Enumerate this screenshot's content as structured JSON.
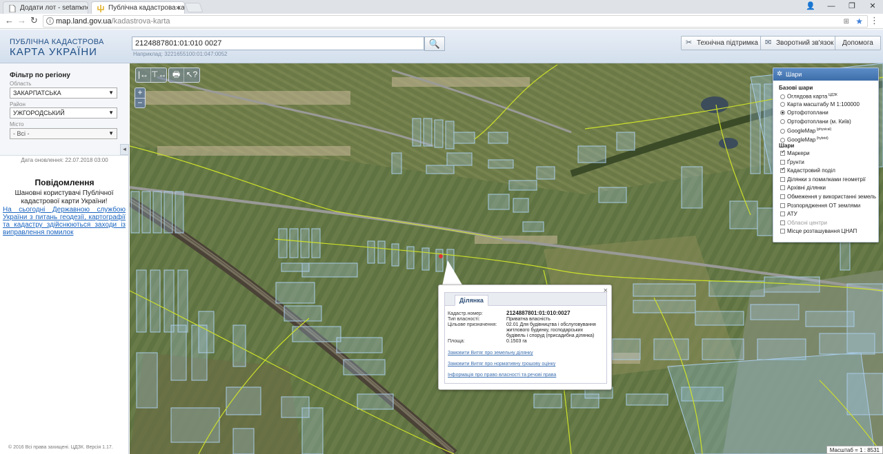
{
  "browser": {
    "tabs": [
      {
        "title": "Додати лот - setam.net.ua",
        "close": "×"
      },
      {
        "title": "Публічна кадастрова ка",
        "close": "×"
      }
    ],
    "window_controls": {
      "user": "👤",
      "minimize": "—",
      "restore": "❐",
      "close": "✕"
    },
    "url_host": "map.land.gov.ua",
    "url_path": "/kadastrova-karta",
    "icons": {
      "back": "←",
      "forward": "→",
      "reload": "↻",
      "info": "i",
      "star": "★",
      "menu": "⋮",
      "ext": "⊞"
    }
  },
  "header": {
    "logo_line1": "ПУБЛІЧНА КАДАСТРОВА",
    "logo_line2": "КАРТА УКРАЇНИ",
    "search_value": "2124887801:01:010 0027",
    "search_hint": "Наприклад: 3221655100:01:047:0052",
    "search_icon": "🔍",
    "support_label": "Технічна підтримка",
    "support_icon": "✂",
    "feedback_label": "Зворотний зв'язок",
    "feedback_icon": "✉",
    "help_label": "Допомога"
  },
  "sidebar": {
    "filter_title": "Фільтр по регіону",
    "region_label": "Область",
    "region_value": "ЗАКАРПАТСЬКА",
    "district_label": "Район",
    "district_value": "УЖГОРОДСЬКИЙ",
    "city_label": "Місто",
    "city_value": "- Всі -",
    "caret": "▼",
    "collapse": "◄",
    "updated": "Дата оновлення: 22.07.2018 03:00",
    "notice_title": "Повідомлення",
    "notice_body": "Шановні користувачі Публічної кадастрової карти України!",
    "notice_link": "На сьогодні Державною службою України з питань геодезії, картографії та кадастру здійснюються заходи із виправлення помилок",
    "footer": "© 2016 Всі права захищені. ЦДЗК. Версія 1.17."
  },
  "map": {
    "tools": {
      "measure_length": "|↔",
      "measure_area": "⊤↔",
      "print": "🖶",
      "identify": "↖?"
    },
    "zoom_in": "+",
    "zoom_out": "−",
    "scale": "Масштаб = 1 : 8531",
    "colors": {
      "parcel_border": "#a9cbe6",
      "boundary": "#cde02a",
      "road": "#9a9a98"
    }
  },
  "layers": {
    "title": "Шари",
    "icon": "✲",
    "base_title": "Базові шари",
    "base": [
      {
        "label": "Оглядова карта",
        "sup": "ЦДЗК",
        "selected": false
      },
      {
        "label": "Карта масштабу М 1:100000",
        "sup": "",
        "selected": false
      },
      {
        "label": "Ортофотоплани",
        "sup": "",
        "selected": true
      },
      {
        "label": "Ортофотоплани (м. Київ)",
        "sup": "",
        "selected": false
      },
      {
        "label": "GoogleMap",
        "sup": "(physical)",
        "selected": false
      },
      {
        "label": "GoogleMap",
        "sup": "(hybrid)",
        "selected": false
      }
    ],
    "overlay_title": "Шари",
    "overlays": [
      {
        "label": "Маркери",
        "checked": true
      },
      {
        "label": "Ґрунти",
        "checked": false
      },
      {
        "label": "Кадастровий поділ",
        "checked": true
      },
      {
        "label": "Ділянки з помилками геометрії",
        "checked": false
      },
      {
        "label": "Архівні ділянки",
        "checked": false
      },
      {
        "label": "Обмеження у використанні земель",
        "checked": false
      },
      {
        "label": "Розпорядження ОТ землями",
        "checked": false
      },
      {
        "label": "АТУ",
        "checked": false
      },
      {
        "label": "Обласні центри",
        "checked": false,
        "disabled": true
      },
      {
        "label": "Місце розташування ЦНАП",
        "checked": false
      }
    ]
  },
  "popup": {
    "close": "×",
    "tab": "Ділянка",
    "cadastre_label": "Кадастр.номер:",
    "cadastre_value": "2124887801:01:010:0027",
    "ownership_label": "Тип власності:",
    "ownership_value": "Приватна власність",
    "purpose_label": "Цільове призначення:",
    "purpose_value": "02.01 Для будівництва і обслуговування житлового будинку, господарських будівель і споруд (присадибна ділянка)",
    "area_label": "Площа:",
    "area_value": "0.1503 га",
    "link1": "Замовити Витяг про земельну ділянку",
    "link2": "Замовити Витяг про нормативну грошову оцінку",
    "link3": "Інформація про право власності та речові права"
  }
}
